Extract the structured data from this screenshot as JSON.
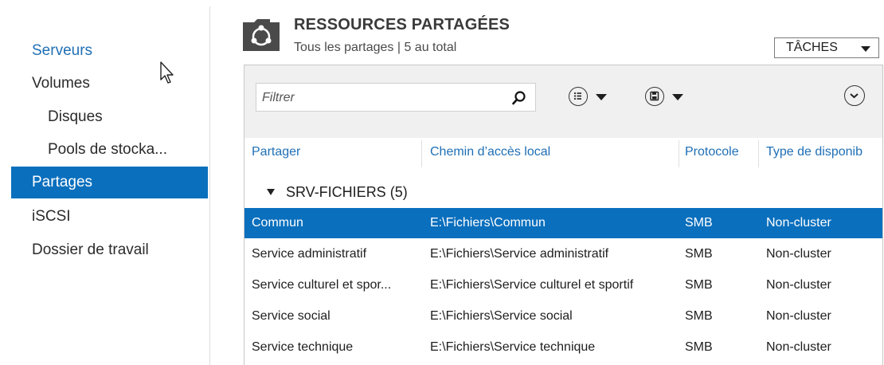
{
  "sidebar": {
    "items": [
      {
        "label": "Serveurs",
        "state": "link"
      },
      {
        "label": "Volumes",
        "state": "normal"
      },
      {
        "label": "Disques",
        "state": "sub"
      },
      {
        "label": "Pools de stocka...",
        "state": "sub"
      },
      {
        "label": "Partages",
        "state": "selected"
      },
      {
        "label": "iSCSI",
        "state": "normal"
      },
      {
        "label": "Dossier de travail",
        "state": "normal"
      }
    ]
  },
  "header": {
    "title": "RESSOURCES PARTAGÉES",
    "subtitle": "Tous les partages | 5 au total",
    "tasks_label": "TÂCHES"
  },
  "toolbar": {
    "filter_placeholder": "Filtrer",
    "filter_value": ""
  },
  "table": {
    "columns": [
      "Partager",
      "Chemin d’accès local",
      "Protocole",
      "Type de disponib"
    ],
    "group": "SRV-FICHIERS (5)",
    "rows": [
      {
        "name": "Commun",
        "path": "E:\\Fichiers\\Commun",
        "protocol": "SMB",
        "availability": "Non-cluster",
        "selected": true
      },
      {
        "name": "Service administratif",
        "path": "E:\\Fichiers\\Service administratif",
        "protocol": "SMB",
        "availability": "Non-cluster",
        "selected": false
      },
      {
        "name": "Service culturel et spor...",
        "path": "E:\\Fichiers\\Service culturel et sportif",
        "protocol": "SMB",
        "availability": "Non-cluster",
        "selected": false
      },
      {
        "name": "Service social",
        "path": "E:\\Fichiers\\Service social",
        "protocol": "SMB",
        "availability": "Non-cluster",
        "selected": false
      },
      {
        "name": "Service technique",
        "path": "E:\\Fichiers\\Service technique",
        "protocol": "SMB",
        "availability": "Non-cluster",
        "selected": false
      }
    ]
  },
  "colors": {
    "accent": "#0a6fbd",
    "link": "#1f6fb5",
    "toolbar_bg": "#f0f0f0"
  }
}
